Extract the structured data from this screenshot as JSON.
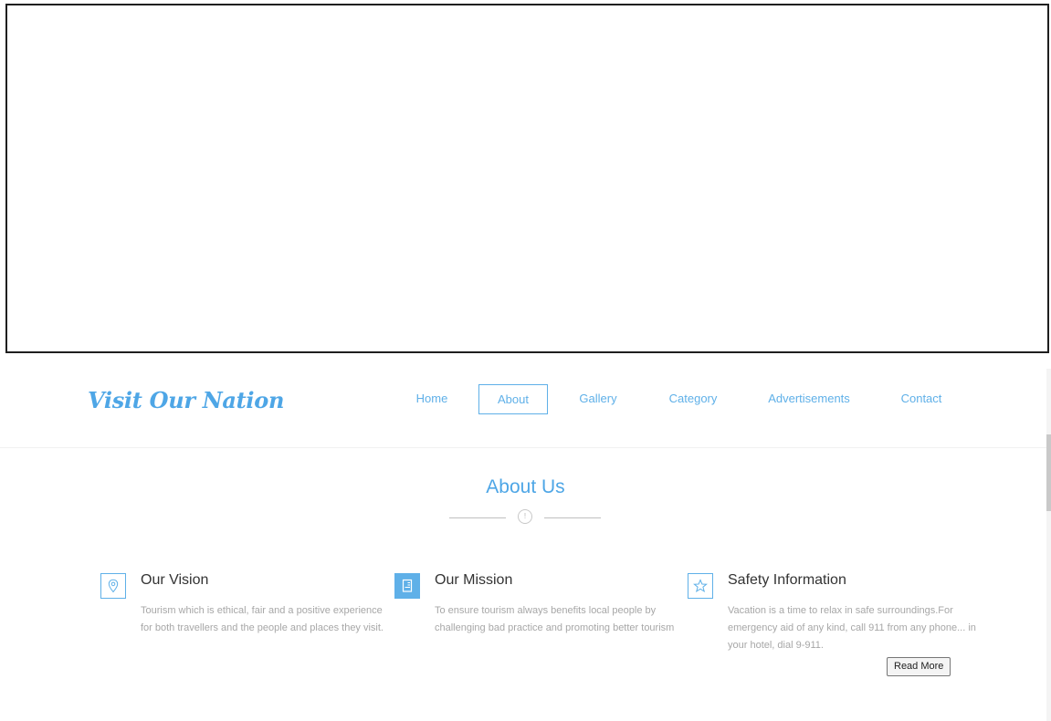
{
  "brand": {
    "name": "Visit Our Nation",
    "color": "#4ea6e6"
  },
  "nav": {
    "active": "About",
    "items": [
      {
        "label": "Home"
      },
      {
        "label": "About"
      },
      {
        "label": "Gallery"
      },
      {
        "label": "Category"
      },
      {
        "label": "Advertisements"
      },
      {
        "label": "Contact"
      }
    ]
  },
  "about": {
    "title": "About Us",
    "divider_icon": "!",
    "features": [
      {
        "icon": "map-pin-icon",
        "title": "Our Vision",
        "description": "Tourism which is ethical, fair and a positive experience for both travellers and the people and places they visit."
      },
      {
        "icon": "document-icon",
        "title": "Our Mission",
        "description": "To ensure tourism always benefits local people by challenging bad practice and promoting better tourism"
      },
      {
        "icon": "star-icon",
        "title": "Safety Information",
        "description": "Vacation is a time to relax in safe surroundings.For emergency aid of any kind, call 911 from any phone... in your hotel, dial 9-911."
      }
    ],
    "read_more_label": "Read More"
  },
  "colors": {
    "accent": "#5fb0e8",
    "heading": "#333333",
    "muted_text": "#a7a7a7"
  }
}
